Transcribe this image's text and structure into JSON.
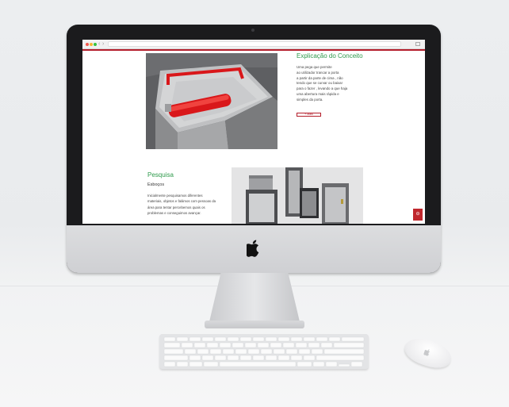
{
  "concept": {
    "title": "Explicação do Conceito",
    "lines": [
      "Uma pega que permite",
      "ao utilizador trancar a porta",
      "a partir da parte de cima , não",
      "tendo que se curvar ou baixar",
      "para o fazer , levando a que haja",
      "uma abertura mais rápida e",
      "simples da porta."
    ],
    "more_label": "+ Mais"
  },
  "research": {
    "title": "Pesquisa",
    "subtitle": "Esboços",
    "lines": [
      "Inicialmente pesquisamos diferentes",
      "materiais, objetos e falámos com pessoas da",
      "área para tentar percebemos quais os",
      "problemas e conseguimos avançar."
    ]
  },
  "colors": {
    "accent_green": "#2e9a4b",
    "accent_red": "#b41e2b"
  },
  "icons": {
    "scroll_top": "up-circle-icon",
    "brand": "apple-logo-icon"
  }
}
